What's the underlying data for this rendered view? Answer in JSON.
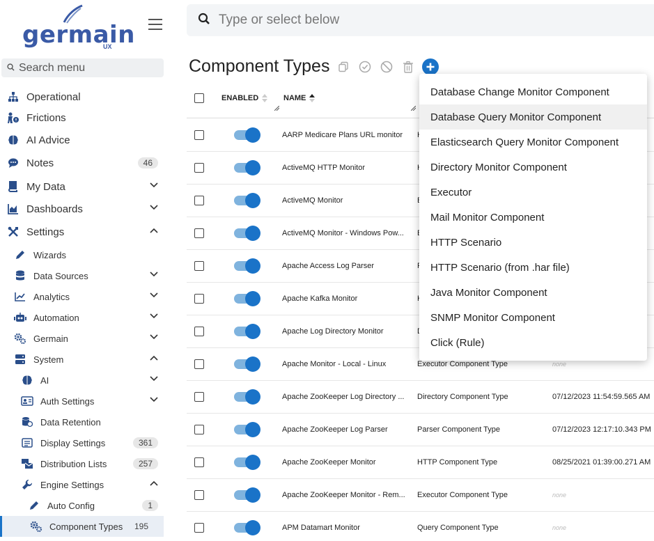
{
  "brand": {
    "name": "germain",
    "sub": "UX"
  },
  "search_menu": {
    "placeholder": "Search menu"
  },
  "nav": {
    "items": [
      {
        "label": "Operational",
        "icon": "sitemap-icon",
        "level": 0
      },
      {
        "label": "Frictions",
        "icon": "user-friction-icon",
        "level": 0
      },
      {
        "label": "AI Advice",
        "icon": "brain-icon",
        "level": 0
      },
      {
        "label": "Notes",
        "icon": "comment-icon",
        "level": 0,
        "badge": "46"
      },
      {
        "label": "My Data",
        "icon": "bookmark-icon",
        "level": 0,
        "chevron": "down"
      },
      {
        "label": "Dashboards",
        "icon": "chart-area-icon",
        "level": 0,
        "chevron": "down"
      },
      {
        "label": "Settings",
        "icon": "tools-icon",
        "level": 0,
        "chevron": "up"
      },
      {
        "label": "Wizards",
        "icon": "pencil-icon",
        "level": 1
      },
      {
        "label": "Data Sources",
        "icon": "database-icon",
        "level": 1,
        "chevron": "down"
      },
      {
        "label": "Analytics",
        "icon": "line-chart-icon",
        "level": 1,
        "chevron": "down"
      },
      {
        "label": "Automation",
        "icon": "robot-icon",
        "level": 1,
        "chevron": "down"
      },
      {
        "label": "Germain",
        "icon": "cogs-icon",
        "level": 1,
        "chevron": "down"
      },
      {
        "label": "System",
        "icon": "server-icon",
        "level": 1,
        "chevron": "up"
      },
      {
        "label": "AI",
        "icon": "brain-icon",
        "level": 2,
        "chevron": "down"
      },
      {
        "label": "Auth Settings",
        "icon": "id-card-icon",
        "level": 2,
        "chevron": "down"
      },
      {
        "label": "Data Retention",
        "icon": "database-clock-icon",
        "level": 2
      },
      {
        "label": "Display Settings",
        "icon": "list-alt-icon",
        "level": 2,
        "badge": "361"
      },
      {
        "label": "Distribution Lists",
        "icon": "mail-bulk-icon",
        "level": 2,
        "badge": "257"
      },
      {
        "label": "Engine Settings",
        "icon": "wrench-icon",
        "level": 2,
        "chevron": "up"
      },
      {
        "label": "Auto Config",
        "icon": "pencil-icon",
        "level": 3,
        "badge": "1"
      },
      {
        "label": "Component Types",
        "icon": "cogs-icon",
        "level": 3,
        "badge": "195",
        "active": true
      }
    ]
  },
  "topbar": {
    "search_placeholder": "Type or select below"
  },
  "page": {
    "title": "Component Types"
  },
  "table": {
    "headers": {
      "enabled": "ENABLED",
      "name": "NAME"
    },
    "rows": [
      {
        "name": "AARP Medicare Plans URL monitor",
        "type": "H",
        "date": "3 A"
      },
      {
        "name": "ActiveMQ HTTP Monitor",
        "type": "H",
        "date": ""
      },
      {
        "name": "ActiveMQ Monitor",
        "type": "E",
        "date": ""
      },
      {
        "name": "ActiveMQ Monitor - Windows Pow...",
        "type": "E",
        "date": ""
      },
      {
        "name": "Apache Access Log Parser",
        "type": "P",
        "date": ""
      },
      {
        "name": "Apache Kafka Monitor",
        "type": "K",
        "date": "1 A"
      },
      {
        "name": "Apache Log Directory Monitor",
        "type": "D",
        "date": ""
      },
      {
        "name": "Apache Monitor - Local - Linux",
        "type": "Executor Component Type",
        "date": "none",
        "muted": true
      },
      {
        "name": "Apache ZooKeeper Log Directory ...",
        "type": "Directory Component Type",
        "date": "07/12/2023 11:54:59.565 AM"
      },
      {
        "name": "Apache ZooKeeper Log Parser",
        "type": "Parser Component Type",
        "date": "07/12/2023 12:17:10.343 PM"
      },
      {
        "name": "Apache ZooKeeper Monitor",
        "type": "HTTP Component Type",
        "date": "08/25/2021 01:39:00.271 AM"
      },
      {
        "name": "Apache ZooKeeper Monitor - Rem...",
        "type": "Executor Component Type",
        "date": "none",
        "muted": true
      },
      {
        "name": "APM Datamart Monitor",
        "type": "Query Component Type",
        "date": "none",
        "muted": true
      }
    ]
  },
  "add_menu": {
    "items": [
      "Database Change Monitor Component",
      "Database Query Monitor Component",
      "Elasticsearch Query Monitor Component",
      "Directory Monitor Component",
      "Executor",
      "Mail Monitor Component",
      "HTTP Scenario",
      "HTTP Scenario (from .har file)",
      "Java Monitor Component",
      "SNMP Monitor Component",
      "Click (Rule)"
    ],
    "hovered_index": 1
  },
  "colors": {
    "accent": "#1a73c8",
    "brand": "#3a5aa6",
    "toggle_track": "#7fb3de"
  }
}
